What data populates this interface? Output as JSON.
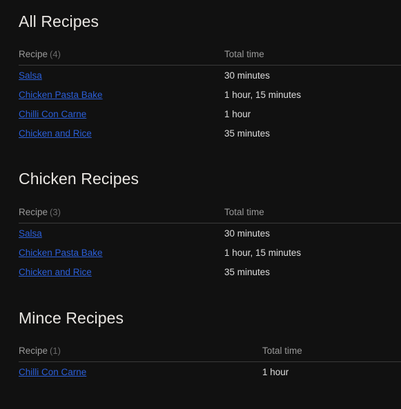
{
  "page": {
    "background_color": "#111111",
    "text_color": "#dedede",
    "heading_color": "#e9e6e2",
    "link_color": "#2b5fd9",
    "muted_color": "#9a9a9a",
    "count_color": "#6b6b6b",
    "divider_color": "#3a3a3a"
  },
  "sections": [
    {
      "title": "All Recipes",
      "columns": {
        "name": "Recipe",
        "count": "(4)",
        "time": "Total time"
      },
      "layout": "narrow",
      "rows": [
        {
          "name": "Salsa",
          "time": "30 minutes"
        },
        {
          "name": "Chicken Pasta Bake",
          "time": "1 hour, 15 minutes"
        },
        {
          "name": "Chilli Con Carne",
          "time": "1 hour"
        },
        {
          "name": "Chicken and Rice",
          "time": "35 minutes"
        }
      ]
    },
    {
      "title": "Chicken Recipes",
      "columns": {
        "name": "Recipe",
        "count": "(3)",
        "time": "Total time"
      },
      "layout": "narrow",
      "rows": [
        {
          "name": "Salsa",
          "time": "30 minutes"
        },
        {
          "name": "Chicken Pasta Bake",
          "time": "1 hour, 15 minutes"
        },
        {
          "name": "Chicken and Rice",
          "time": "35 minutes"
        }
      ]
    },
    {
      "title": "Mince Recipes",
      "columns": {
        "name": "Recipe",
        "count": "(1)",
        "time": "Total time"
      },
      "layout": "wide",
      "rows": [
        {
          "name": "Chilli Con Carne",
          "time": "1 hour"
        }
      ]
    }
  ]
}
